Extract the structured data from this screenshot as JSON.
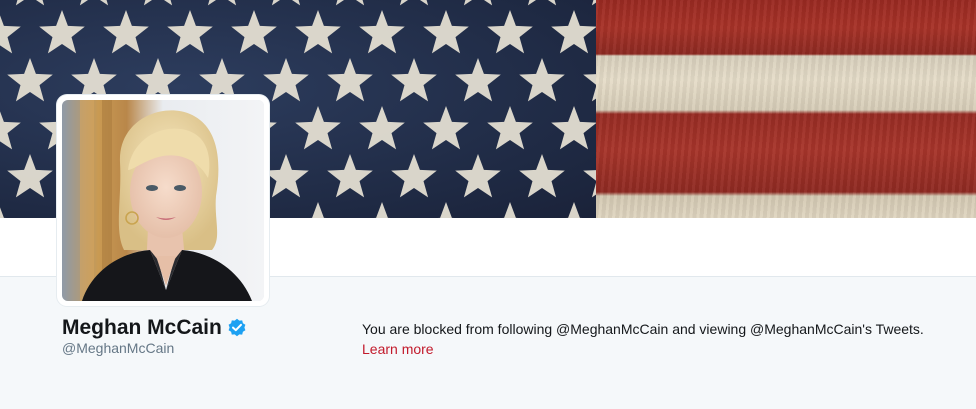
{
  "profile": {
    "display_name": "Meghan McCain",
    "handle": "@MeghanMcCain",
    "verified": true
  },
  "notice": {
    "blocked_message": "You are blocked from following @MeghanMcCain and viewing @MeghanMcCain's Tweets.",
    "learn_more_label": "Learn more"
  },
  "colors": {
    "link": "#c21a2b",
    "verified_badge": "#1da1f2",
    "name_text": "#14171a",
    "handle_text": "#657786",
    "page_background": "#f5f8fa"
  },
  "icons": {
    "verified": "verified-badge-icon"
  }
}
